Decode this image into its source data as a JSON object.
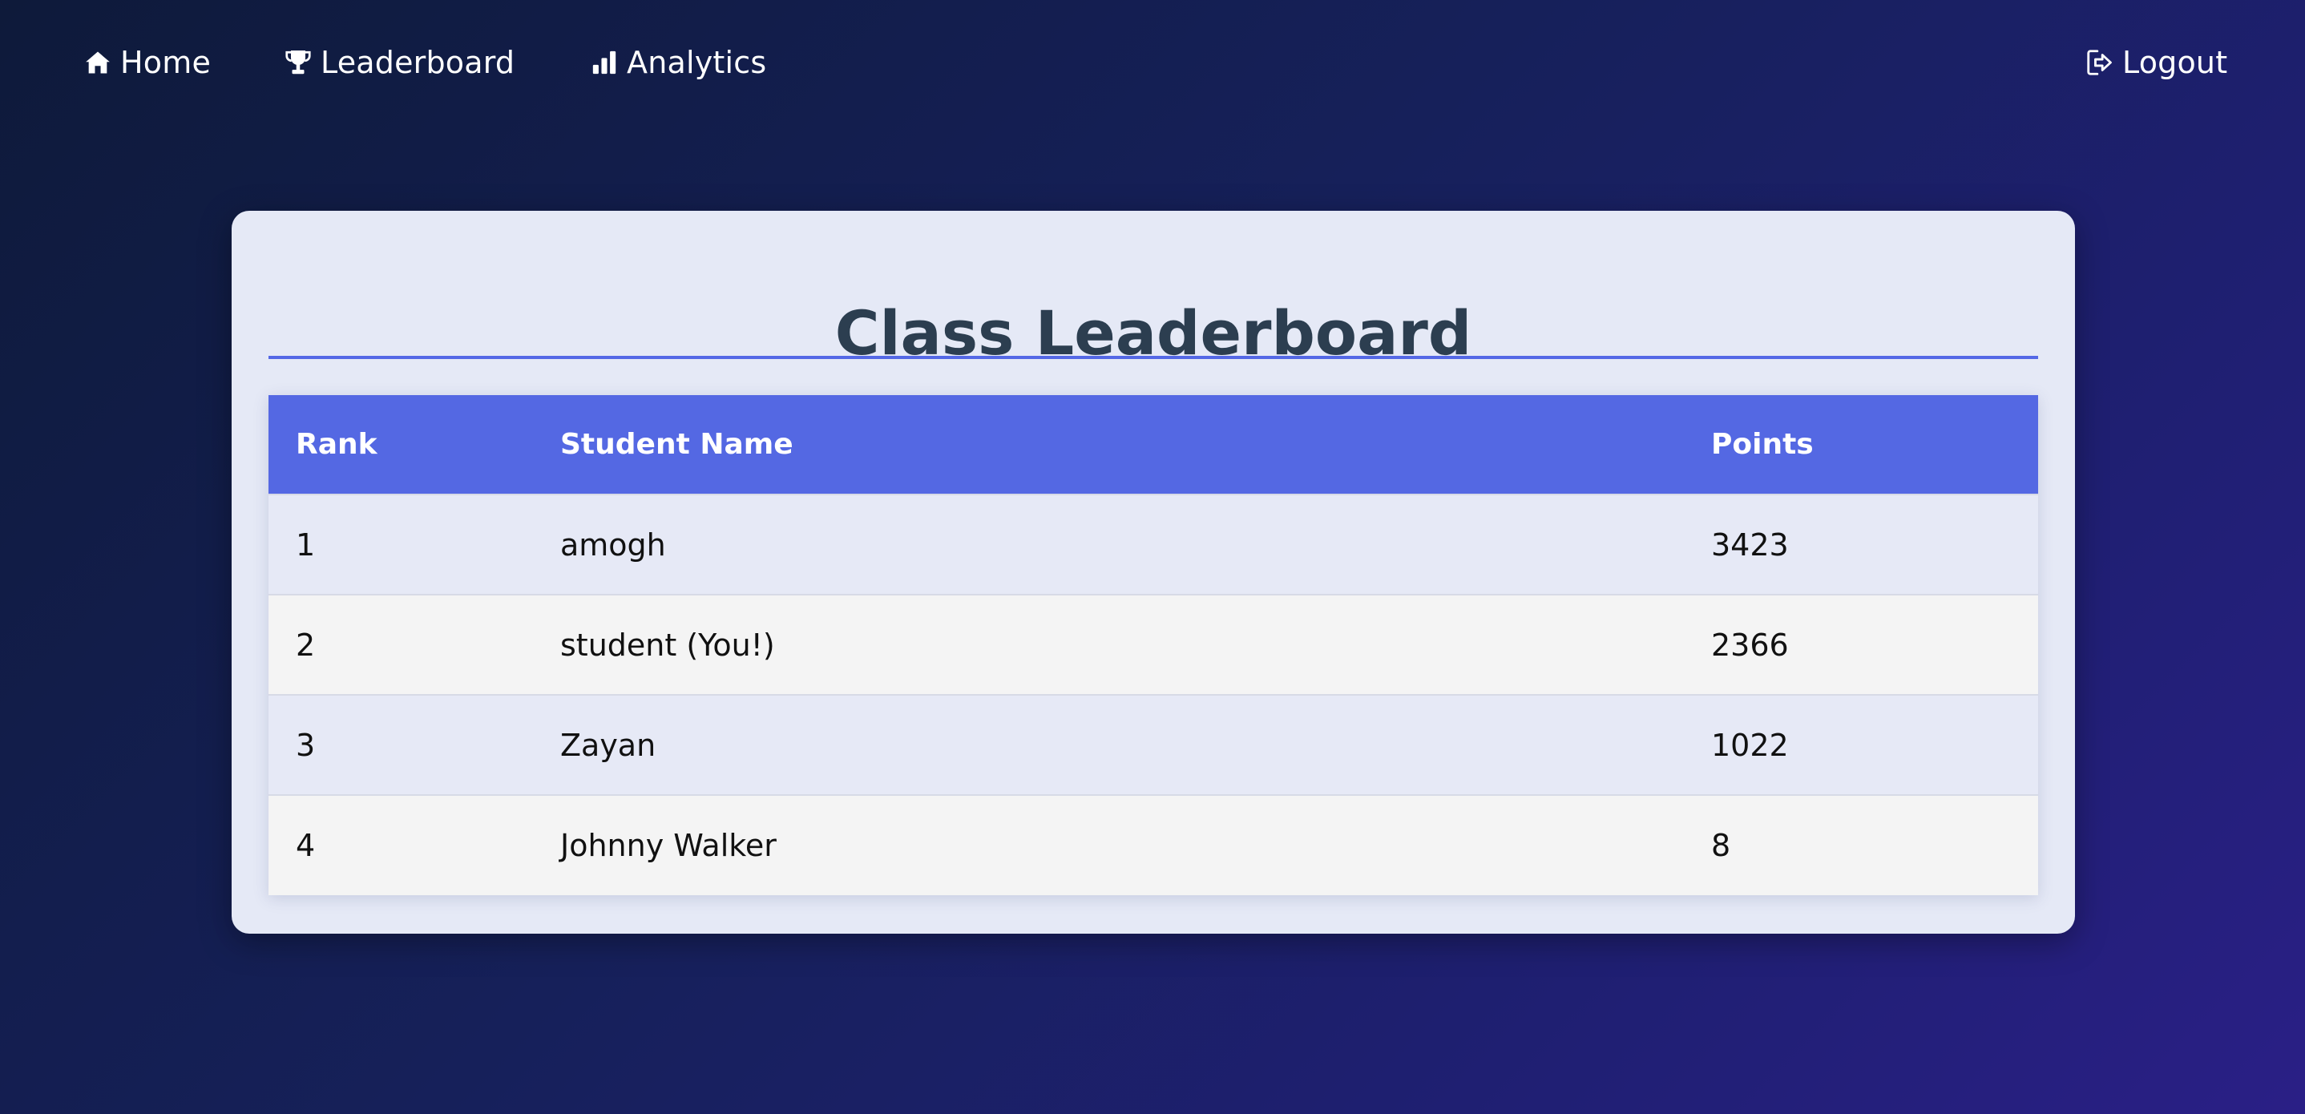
{
  "nav": {
    "home": {
      "label": "Home",
      "icon": "home-icon"
    },
    "leaderboard": {
      "label": "Leaderboard",
      "icon": "trophy-icon"
    },
    "analytics": {
      "label": "Analytics",
      "icon": "bar-chart-icon"
    },
    "logout": {
      "label": "Logout",
      "icon": "logout-icon"
    }
  },
  "card": {
    "title": "Class Leaderboard"
  },
  "table": {
    "headers": {
      "rank": "Rank",
      "name": "Student Name",
      "points": "Points"
    },
    "rows": [
      {
        "rank": "1",
        "name": "amogh",
        "points": "3423"
      },
      {
        "rank": "2",
        "name": "student (You!)",
        "points": "2366"
      },
      {
        "rank": "3",
        "name": "Zayan",
        "points": "1022"
      },
      {
        "rank": "4",
        "name": "Johnny Walker",
        "points": "8"
      }
    ]
  },
  "colors": {
    "accent": "#5468e3",
    "card_background": "#e5e9f6",
    "title_text": "#2c3e50"
  }
}
